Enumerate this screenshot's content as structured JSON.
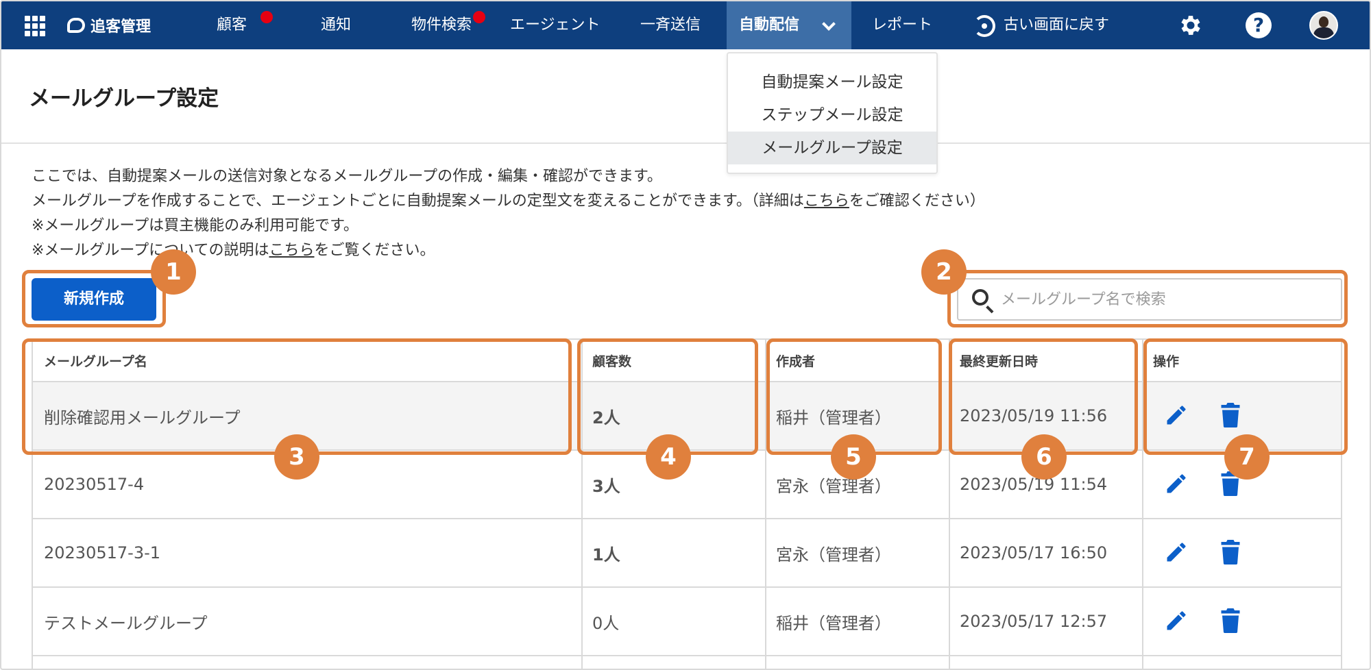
{
  "nav": {
    "brand": "追客管理",
    "items": [
      "顧客",
      "通知",
      "物件検索",
      "エージェント",
      "一斉送信"
    ],
    "active": "自動配信",
    "report": "レポート",
    "back": "古い画面に戻す",
    "notification_color": "#e60012",
    "accent": "#0e3f7e"
  },
  "dropdown": {
    "items": [
      "自動提案メール設定",
      "ステップメール設定",
      "メールグループ設定"
    ]
  },
  "page": {
    "title": "メールグループ設定",
    "desc1": "ここでは、自動提案メールの送信対象となるメールグループの作成・編集・確認ができます。",
    "desc2a": "メールグループを作成することで、エージェントごとに自動提案メールの定型文を変えることができます。（詳細は",
    "desc2link": "こちら",
    "desc2b": "をご確認ください）",
    "desc3": "※メールグループは買主機能のみ利用可能です。",
    "desc4a": "※メールグループについての説明は",
    "desc4link": "こちら",
    "desc4b": "をご覧ください。"
  },
  "create_button": "新規作成",
  "search": {
    "placeholder": "メールグループ名で検索"
  },
  "table": {
    "headers": [
      "メールグループ名",
      "顧客数",
      "作成者",
      "最終更新日時",
      "操作"
    ],
    "rows": [
      {
        "name": "削除確認用メールグループ",
        "count": "2人",
        "creator": "稲井（管理者）",
        "updated": "2023/05/19 11:56"
      },
      {
        "name": "20230517-4",
        "count": "3人",
        "creator": "宮永（管理者）",
        "updated": "2023/05/19 11:54"
      },
      {
        "name": "20230517-3-1",
        "count": "1人",
        "creator": "宮永（管理者）",
        "updated": "2023/05/17 16:50"
      },
      {
        "name": "テストメールグループ",
        "count": "0人",
        "creator": "稲井（管理者）",
        "updated": "2023/05/17 12:57"
      }
    ]
  },
  "badges": [
    "1",
    "2",
    "3",
    "4",
    "5",
    "6",
    "7"
  ],
  "annotation_color": "#e0803d"
}
